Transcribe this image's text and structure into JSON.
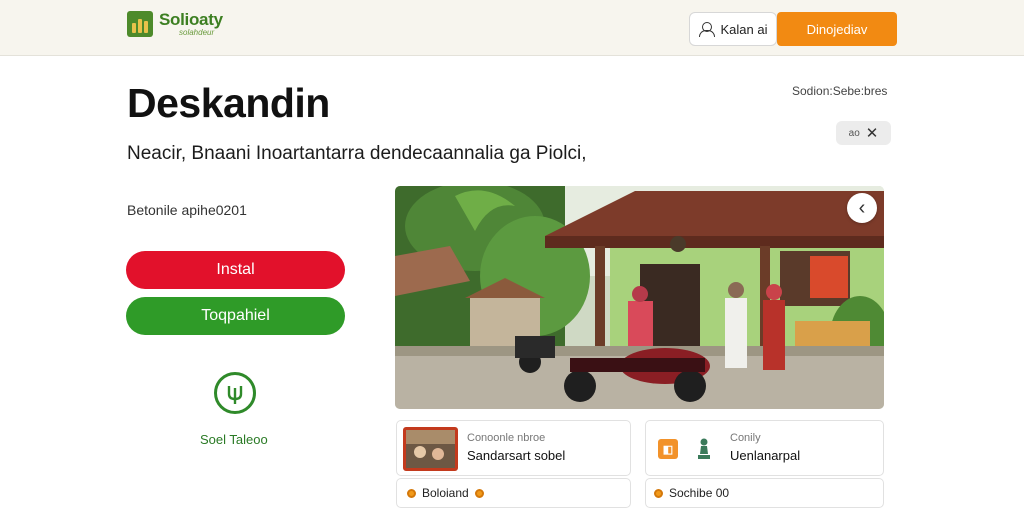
{
  "header": {
    "logo_name": "Solioaty",
    "logo_sub": "solahdeur",
    "login_label": "Kalan ai",
    "cta_label": "Dinojediav"
  },
  "hero": {
    "title": "Deskandin",
    "subtitle": "Neacir, Bnaani Inoartantarra dendecaannalia ga Piolci,",
    "right_note": "Sodion:Sebe:bres",
    "close_chip_text": "ao"
  },
  "left": {
    "meta": "Betonile apihe0201",
    "primary_button": "Instal",
    "secondary_button": "Toqpahiel",
    "badge_label": "Soel Taleoo"
  },
  "cards": [
    {
      "label": "Conoonle nbroe",
      "value": "Sandarsart sobel",
      "footer": "Boloiand"
    },
    {
      "label": "Conily",
      "value": "Uenlanarpal",
      "footer": "Sochibe 00"
    }
  ],
  "colors": {
    "accent_orange": "#f28a12",
    "danger_red": "#e2112b",
    "brand_green": "#2f9b28"
  },
  "icons": {
    "login": "user-icon",
    "close": "close-icon",
    "carousel_prev": "chevron-left-icon",
    "badge": "leaf-badge-icon"
  }
}
